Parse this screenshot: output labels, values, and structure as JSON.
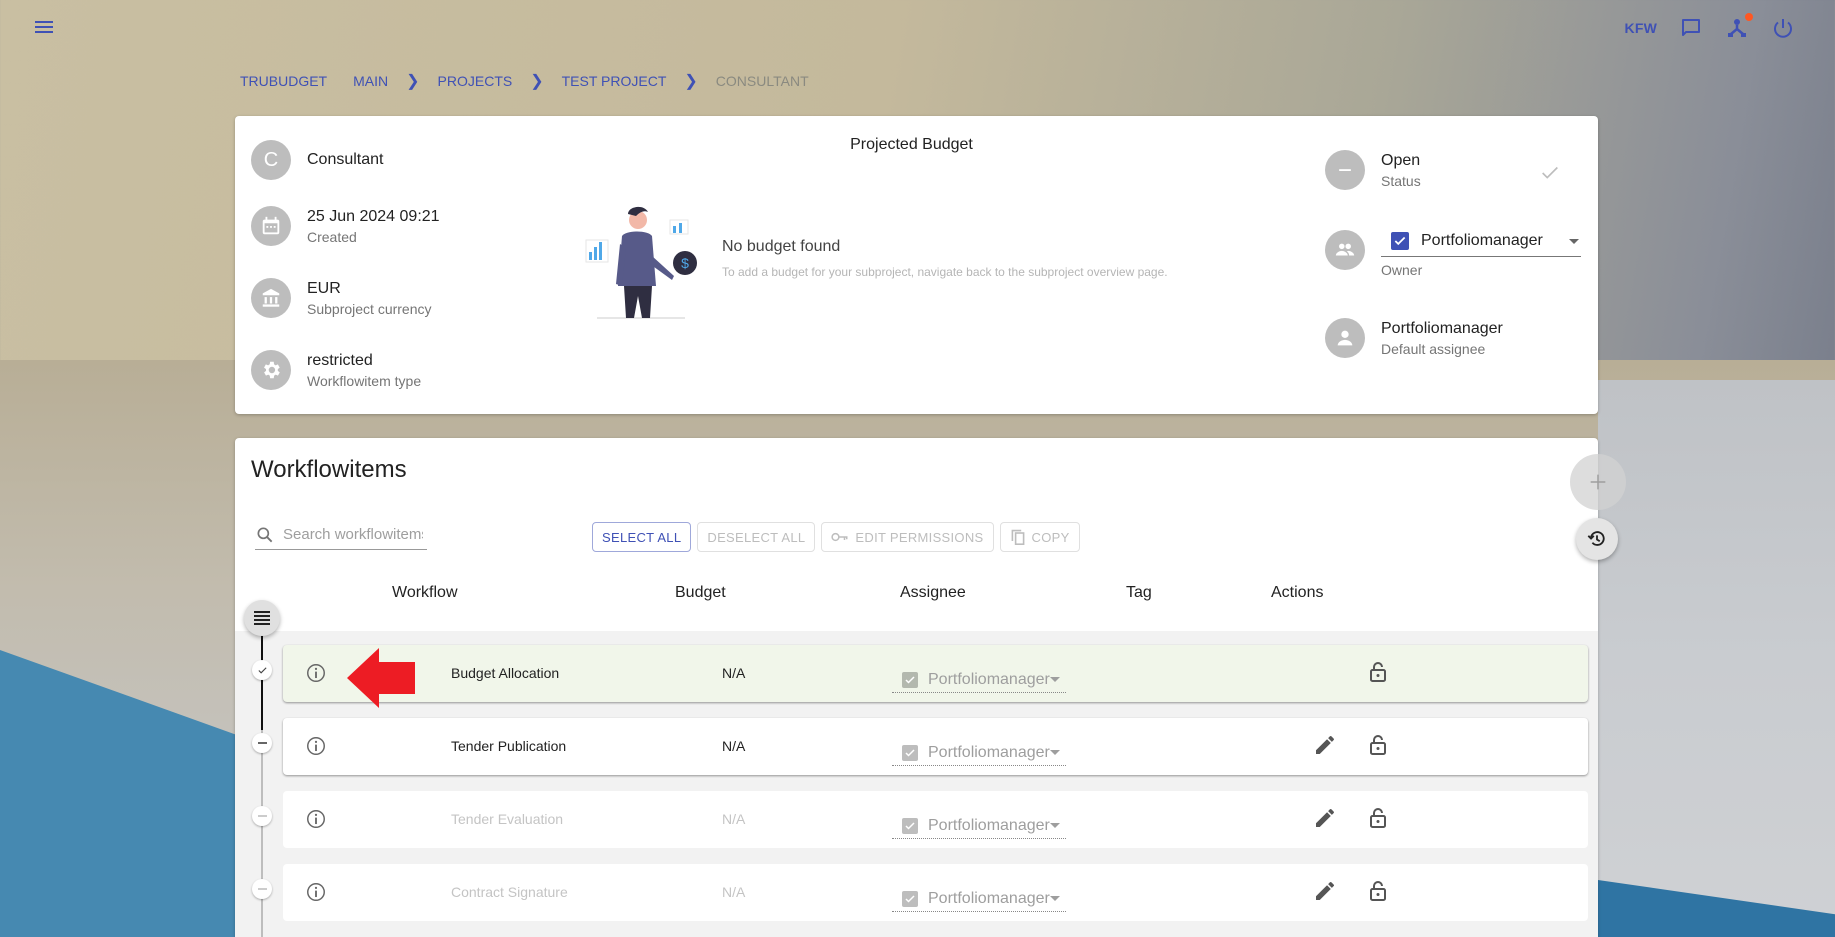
{
  "header": {
    "organization": "KFW",
    "icons": [
      "menu-icon",
      "chat-icon",
      "network-icon",
      "power-icon"
    ],
    "notification_dot_color": "#ff5722",
    "accent_color": "#3f51b5"
  },
  "breadcrumb": {
    "items": [
      "TRUBUDGET",
      "MAIN",
      "PROJECTS",
      "TEST PROJECT",
      "CONSULTANT"
    ]
  },
  "details": {
    "name": {
      "avatar_letter": "C",
      "value": "Consultant"
    },
    "created": {
      "value": "25 Jun 2024 09:21",
      "label": "Created"
    },
    "currency": {
      "value": "EUR",
      "label": "Subproject currency"
    },
    "workflowitem_type": {
      "value": "restricted",
      "label": "Workflowitem type"
    },
    "projected_budget": {
      "title": "Projected Budget",
      "empty_title": "No budget found",
      "empty_text": "To add a budget for your subproject, navigate back to the subproject overview page."
    },
    "status": {
      "value": "Open",
      "label": "Status"
    },
    "owner": {
      "value": "Portfoliomanager",
      "label": "Owner"
    },
    "default_assignee": {
      "value": "Portfoliomanager",
      "label": "Default assignee"
    }
  },
  "workflowitems": {
    "title": "Workflowitems",
    "search_placeholder": "Search workflowitems",
    "buttons": {
      "select_all": "Select all",
      "deselect_all": "Deselect all",
      "edit_permissions": "Edit permissions",
      "copy": "Copy"
    },
    "columns": [
      "Workflow",
      "Budget",
      "Assignee",
      "Tag",
      "Actions"
    ],
    "rows": [
      {
        "name": "Budget Allocation",
        "budget": "N/A",
        "assignee": "Portfoliomanager",
        "tag": "",
        "status": "closed"
      },
      {
        "name": "Tender Publication",
        "budget": "N/A",
        "assignee": "Portfoliomanager",
        "tag": "",
        "status": "open"
      },
      {
        "name": "Tender Evaluation",
        "budget": "N/A",
        "assignee": "Portfoliomanager",
        "tag": "",
        "status": "open-disabled"
      },
      {
        "name": "Contract Signature",
        "budget": "N/A",
        "assignee": "Portfoliomanager",
        "tag": "",
        "status": "open-disabled"
      }
    ],
    "closed_row_color": "#f1f6ea"
  },
  "annotation": {
    "type": "red-arrow",
    "color": "#ed1c24",
    "points_to": "Budget Allocation info icon"
  }
}
